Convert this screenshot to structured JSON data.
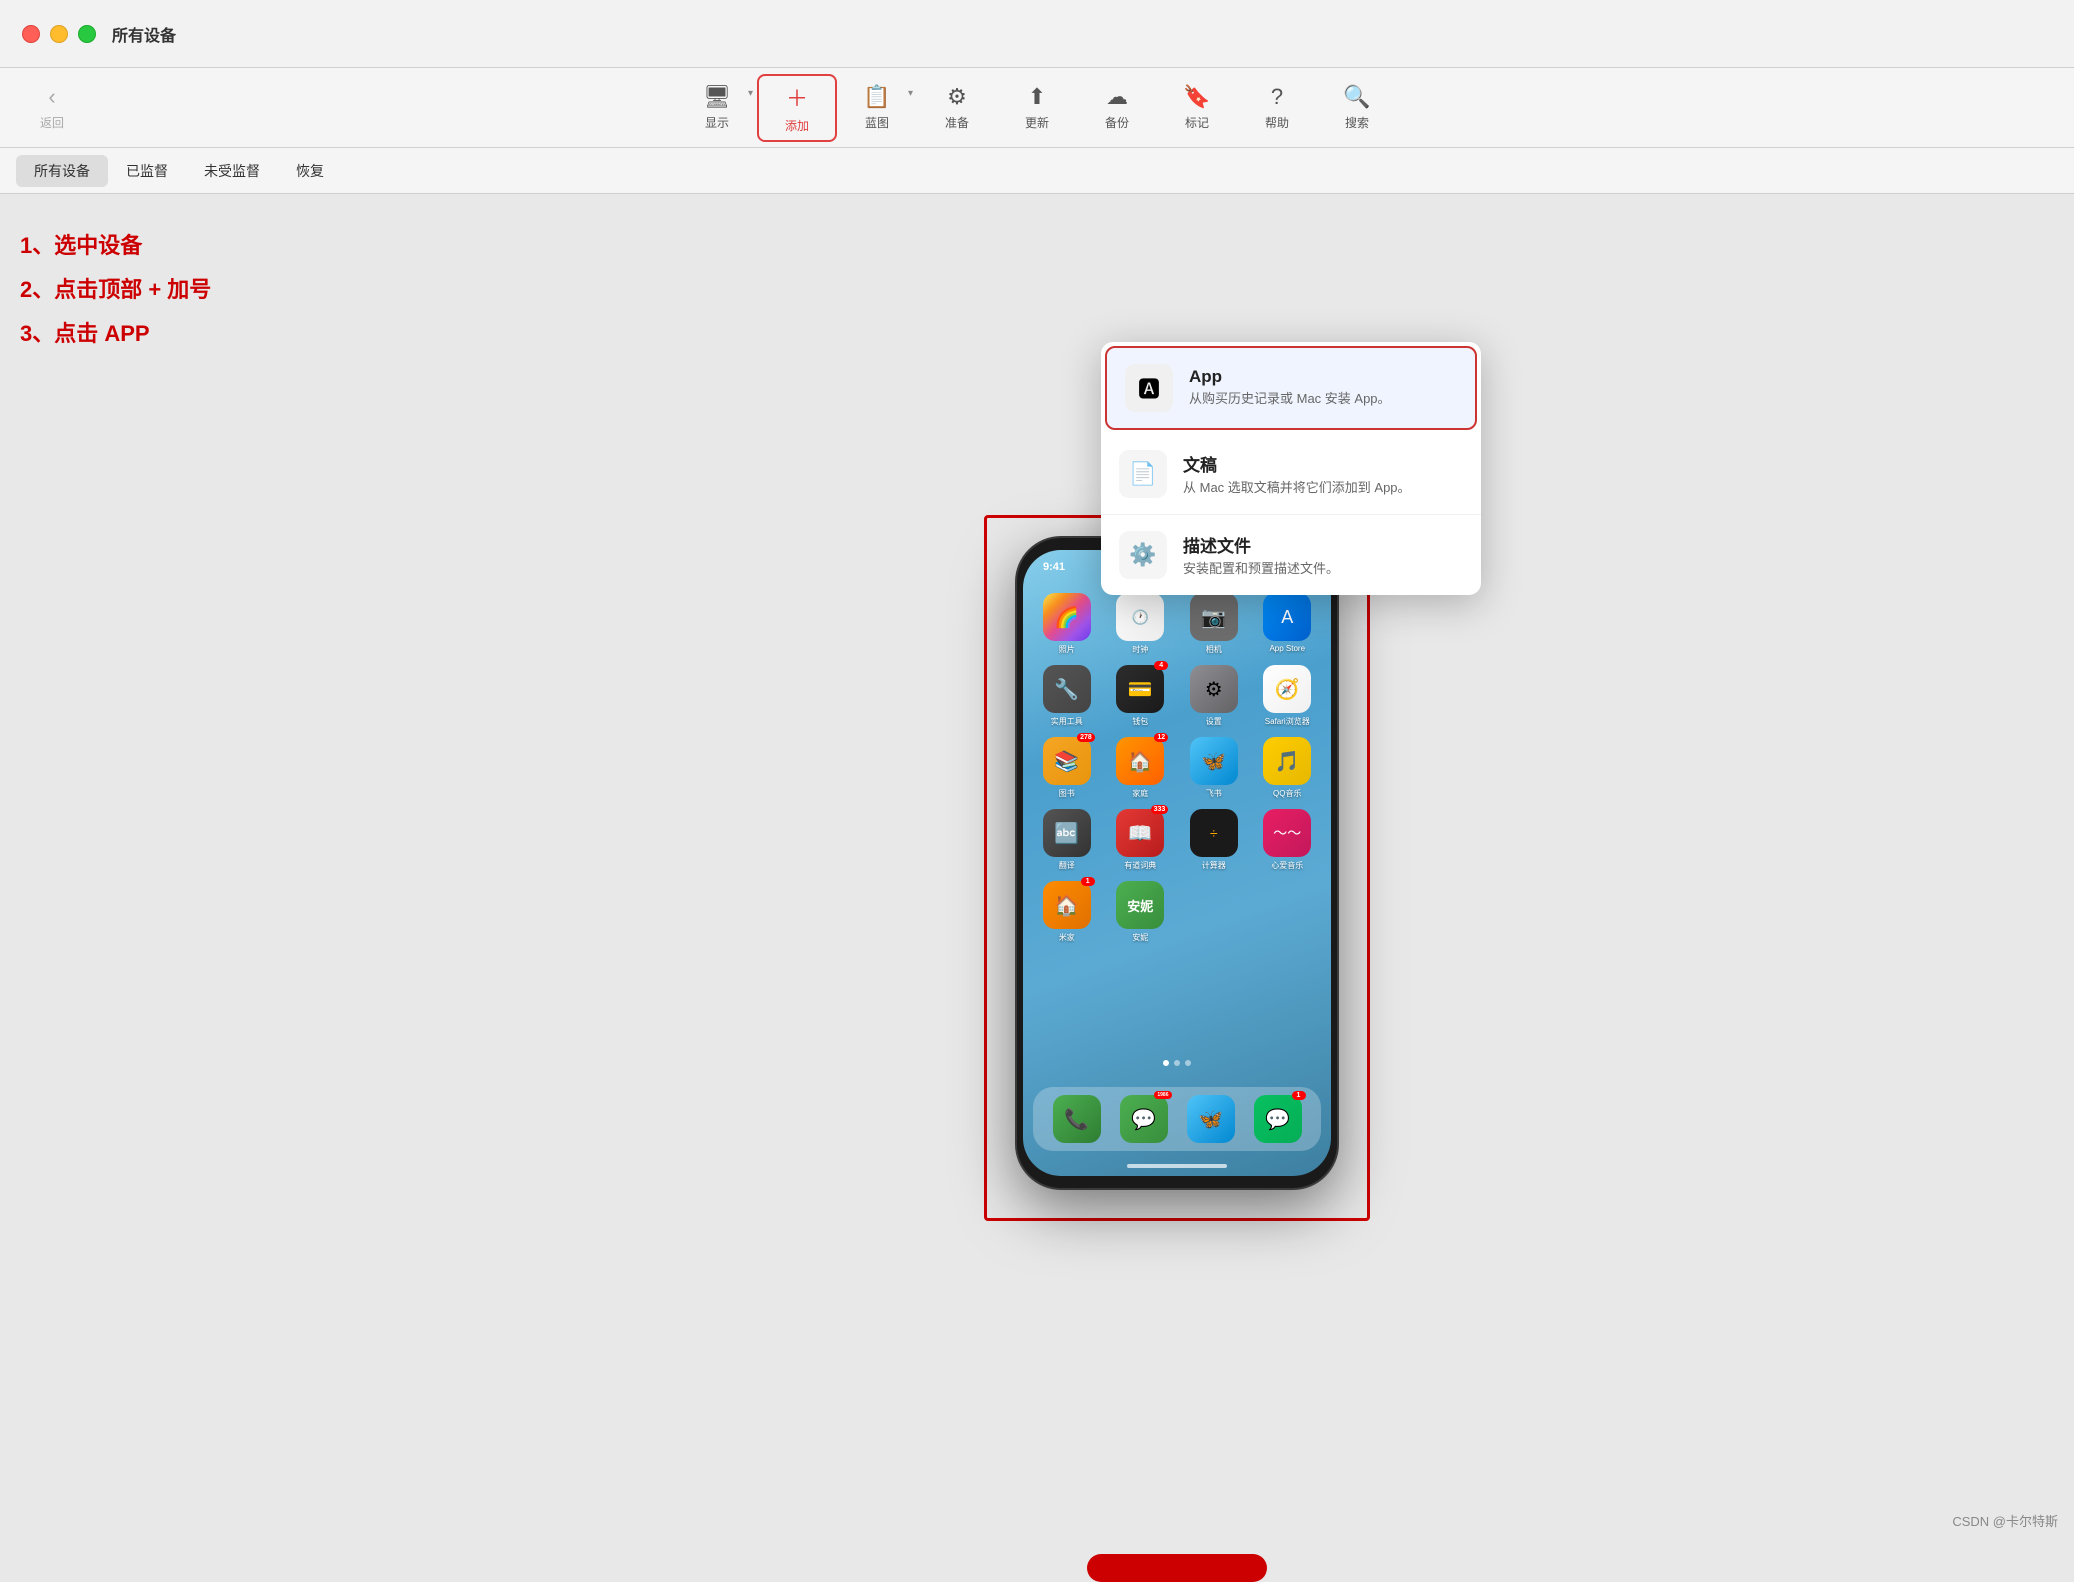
{
  "window": {
    "title": "所有设备",
    "traffic_lights": [
      "red",
      "yellow",
      "green"
    ]
  },
  "toolbar": {
    "back_label": "返回",
    "display_label": "显示",
    "add_label": "添加",
    "blueprint_label": "蓝图",
    "prepare_label": "准备",
    "update_label": "更新",
    "backup_label": "备份",
    "mark_label": "标记",
    "help_label": "帮助",
    "search_label": "搜索"
  },
  "subbar": {
    "items": [
      "所有设备",
      "已监督",
      "未受监督",
      "恢复"
    ]
  },
  "instructions": {
    "line1": "1、选中设备",
    "line2": "2、点击顶部 + 加号",
    "line3": "3、点击 APP"
  },
  "dropdown": {
    "items": [
      {
        "title": "App",
        "desc": "从购买历史记录或 Mac 安装 App。",
        "icon": "🅰",
        "selected": true
      },
      {
        "title": "文稿",
        "desc": "从 Mac 选取文稿并将它们添加到 App。",
        "icon": "📄",
        "selected": false
      },
      {
        "title": "描述文件",
        "desc": "安装配置和预置描述文件。",
        "icon": "⚙️",
        "selected": false
      }
    ]
  },
  "phone": {
    "status_time": "9:41",
    "apps": [
      {
        "name": "照片",
        "class": "app-photos",
        "icon": "🌈"
      },
      {
        "name": "时钟",
        "class": "app-clock",
        "icon": "🕐"
      },
      {
        "name": "相机",
        "class": "app-camera",
        "icon": "📷"
      },
      {
        "name": "App Store",
        "class": "app-appstore",
        "icon": "🅰"
      },
      {
        "name": "实用工具",
        "class": "app-tools",
        "icon": "🔧"
      },
      {
        "name": "钱包",
        "class": "app-wallet",
        "icon": "💳",
        "badge": "4"
      },
      {
        "name": "设置",
        "class": "app-settings",
        "icon": "⚙"
      },
      {
        "name": "Safari浏览器",
        "class": "app-safari",
        "icon": "🧭"
      },
      {
        "name": "图书",
        "class": "app-books",
        "icon": "📚",
        "badge": "278"
      },
      {
        "name": "家庭",
        "class": "app-home",
        "icon": "🏠",
        "badge": "12"
      },
      {
        "name": "飞书",
        "class": "app-feather",
        "icon": "🦋"
      },
      {
        "name": "QQ音乐",
        "class": "app-qqmusic",
        "icon": "🎵"
      },
      {
        "name": "翻译",
        "class": "app-translate",
        "icon": "🔤"
      },
      {
        "name": "有道词典",
        "class": "app-youdao",
        "icon": "📖",
        "badge": "333"
      },
      {
        "name": "计算器",
        "class": "app-calc",
        "icon": "🔢"
      },
      {
        "name": "心爱音乐",
        "class": "app-wave",
        "icon": "〜"
      },
      {
        "name": "米家",
        "class": "app-mijia",
        "icon": "🏠",
        "badge": "1"
      },
      {
        "name": "安妮",
        "class": "app-360",
        "icon": "🛡",
        "badge": ""
      },
      {
        "name": "电话",
        "class": "app-phone",
        "icon": "📞"
      },
      {
        "name": "信息",
        "class": "app-message",
        "icon": "💬",
        "badge": "1986"
      },
      {
        "name": "飞书",
        "class": "app-spark",
        "icon": "🦋"
      },
      {
        "name": "微信",
        "class": "app-wechat",
        "icon": "💬",
        "badge": "1"
      }
    ]
  },
  "watermark": "CSDN @卡尔特斯"
}
